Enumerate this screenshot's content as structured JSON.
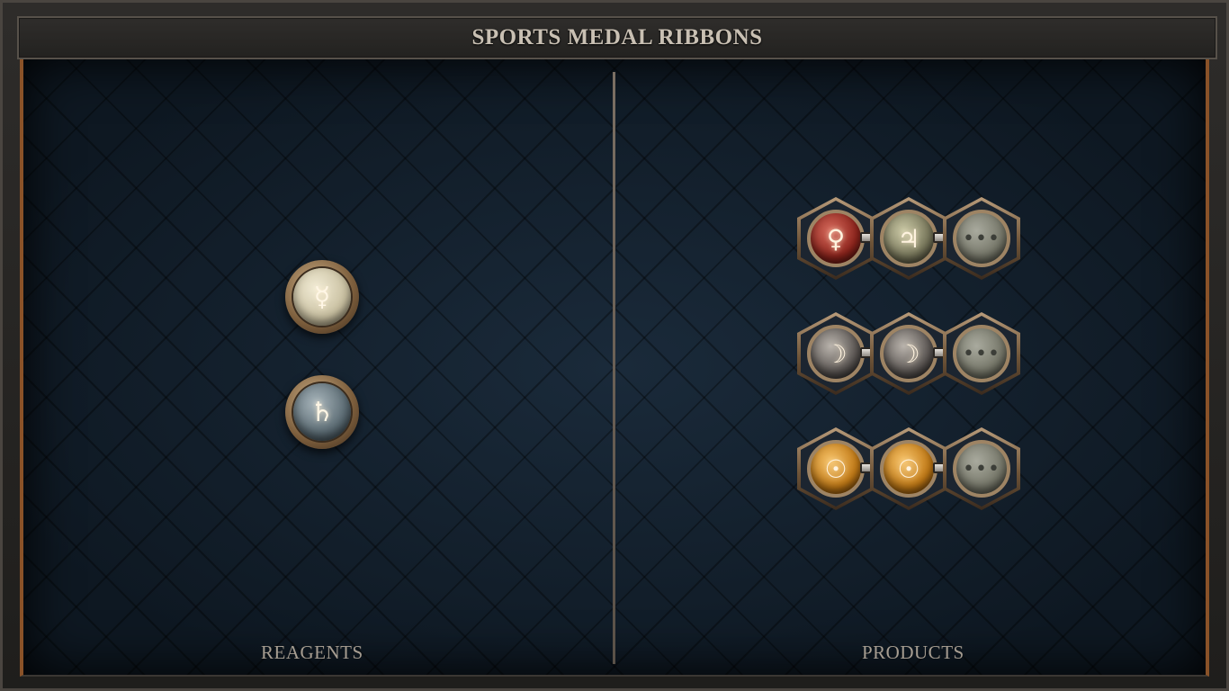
{
  "title": "SPORTS MEDAL RIBBONS",
  "panels": {
    "left_label": "REAGENTS",
    "right_label": "PRODUCTS"
  },
  "reagents": [
    {
      "symbol": "☿",
      "name": "mercury",
      "color": "#d9d2b8"
    },
    {
      "symbol": "♄",
      "name": "saturn",
      "color": "#6f8087"
    }
  ],
  "products": [
    {
      "slots": [
        {
          "symbol": "♀",
          "name": "venus",
          "color": "#9e2e26"
        },
        {
          "symbol": "♃",
          "name": "jupiter",
          "color": "#7b7a5a"
        },
        {
          "symbol": "•••",
          "name": "empty",
          "color": "#7d7e72"
        }
      ]
    },
    {
      "slots": [
        {
          "symbol": "☽",
          "name": "moon",
          "color": "#5a5552"
        },
        {
          "symbol": "☽",
          "name": "moon",
          "color": "#5a5552"
        },
        {
          "symbol": "•••",
          "name": "empty",
          "color": "#7d7e72"
        }
      ]
    },
    {
      "slots": [
        {
          "symbol": "☉",
          "name": "sun",
          "color": "#c27a16"
        },
        {
          "symbol": "☉",
          "name": "sun",
          "color": "#c27a16"
        },
        {
          "symbol": "•••",
          "name": "empty",
          "color": "#7d7e72"
        }
      ]
    }
  ]
}
